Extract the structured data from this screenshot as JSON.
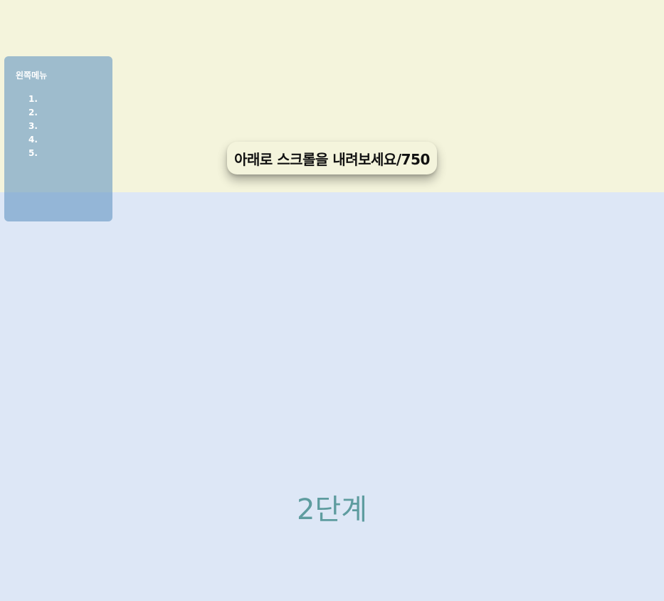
{
  "sections": {
    "top_bg": "#f4f4dc",
    "bottom_bg": "#dde7f6"
  },
  "left_menu": {
    "title": "왼쪽메뉴",
    "items": [
      {
        "label": "1."
      },
      {
        "label": "2."
      },
      {
        "label": "3."
      },
      {
        "label": "4."
      },
      {
        "label": "5."
      }
    ]
  },
  "scroll_indicator": {
    "text": "아래로 스크롤을 내려보세요/750"
  },
  "stage": {
    "label": "2단계"
  }
}
